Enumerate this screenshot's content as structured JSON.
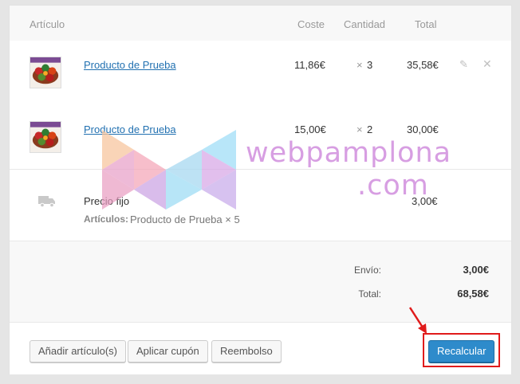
{
  "table": {
    "headers": {
      "item": "Artículo",
      "cost": "Coste",
      "quantity": "Cantidad",
      "total": "Total"
    },
    "items": [
      {
        "name": "Producto de Prueba",
        "cost": "11,86€",
        "qty_prefix": "×",
        "qty": "3",
        "total": "35,58€"
      },
      {
        "name": "Producto de Prueba",
        "cost": "15,00€",
        "qty_prefix": "×",
        "qty": "2",
        "total": "30,00€"
      }
    ]
  },
  "shipping": {
    "name": "Precio fijo",
    "meta_label": "Artículos:",
    "meta_value": "Producto de Prueba × 5",
    "total": "3,00€"
  },
  "totals": {
    "shipping_label": "Envío:",
    "shipping_value": "3,00€",
    "total_label": "Total:",
    "total_value": "68,58€"
  },
  "actions": {
    "add_item": "Añadir artículo(s)",
    "apply_coupon": "Aplicar cupón",
    "refund": "Reembolso",
    "recalculate": "Recalcular"
  },
  "watermark": {
    "line1": "webpamplona",
    "line2": ".com"
  },
  "colors": {
    "link": "#2271b1",
    "primary": "#2e8bcb",
    "highlight": "#e01b1b",
    "watermark": "#d79ee2"
  },
  "icons": [
    "edit-icon",
    "delete-icon",
    "truck-icon",
    "product-thumbnail",
    "red-arrow"
  ]
}
